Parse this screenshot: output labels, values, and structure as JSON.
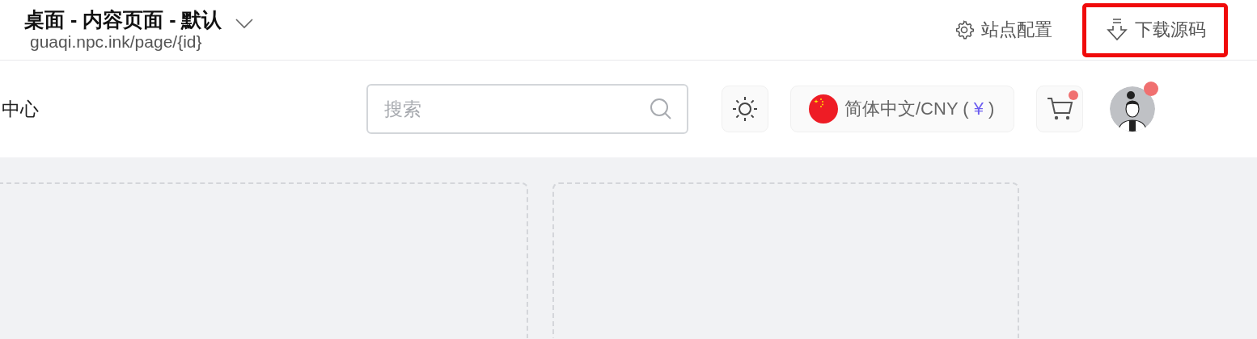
{
  "header": {
    "title": "桌面 - 内容页面 - 默认",
    "url": "guaqi.npc.ink/page/{id}",
    "actions": [
      {
        "kind": "settings",
        "label": "站点配置",
        "highlighted": false
      },
      {
        "kind": "download",
        "label": "下载源码",
        "highlighted": true
      }
    ]
  },
  "nav": {
    "menu_item": "中心",
    "search": {
      "placeholder": "搜索"
    },
    "language": {
      "label": "简体中文/CNY (",
      "currency": "¥",
      "close": ")"
    },
    "cart": {
      "notification": true
    },
    "avatar": {
      "notification": true
    }
  },
  "content": {
    "cards": [
      {
        "kind": "empty"
      },
      {
        "kind": "empty"
      }
    ]
  }
}
